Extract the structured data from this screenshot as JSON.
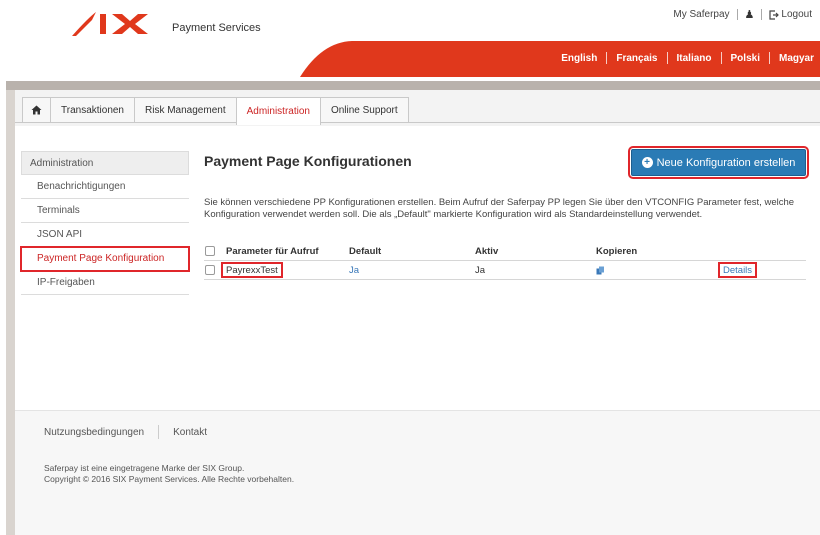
{
  "brand": {
    "subtitle": "Payment Services"
  },
  "top_links": {
    "account": "My Saferpay",
    "logout": "Logout"
  },
  "languages": [
    "English",
    "Français",
    "Italiano",
    "Polski",
    "Magyar"
  ],
  "tabs": [
    {
      "label": "Transaktionen"
    },
    {
      "label": "Risk Management"
    },
    {
      "label": "Administration"
    },
    {
      "label": "Online Support"
    }
  ],
  "sidebar": {
    "heading": "Administration",
    "items": [
      {
        "label": "Benachrichtigungen"
      },
      {
        "label": "Terminals"
      },
      {
        "label": "JSON API"
      },
      {
        "label": "Payment Page Konfiguration"
      },
      {
        "label": "IP-Freigaben"
      }
    ]
  },
  "main": {
    "title": "Payment Page Konfigurationen",
    "new_button": "Neue Konfiguration erstellen",
    "description": "Sie können verschiedene PP Konfigurationen erstellen. Beim Aufruf der Saferpay PP legen Sie über den VTCONFIG Parameter fest, welche Konfiguration verwendet werden soll. Die als „Default\" markierte Konfiguration wird als Standardeinstellung verwendet."
  },
  "table": {
    "columns": [
      "Parameter für Aufruf",
      "Default",
      "Aktiv",
      "Kopieren"
    ],
    "rows": [
      {
        "parameter": "PayrexxTest",
        "default": "Ja",
        "active": "Ja",
        "details": "Details"
      }
    ]
  },
  "footer": {
    "links": [
      "Nutzungsbedingungen",
      "Kontakt"
    ],
    "trademark": "Saferpay ist eine eingetragene Marke der SIX Group.",
    "copyright": "Copyright © 2016 SIX Payment Services. Alle Rechte vorbehalten."
  },
  "colors": {
    "brand_red": "#e0381c",
    "accent_blue": "#2a7bb5",
    "highlight_red": "#e0262b"
  }
}
